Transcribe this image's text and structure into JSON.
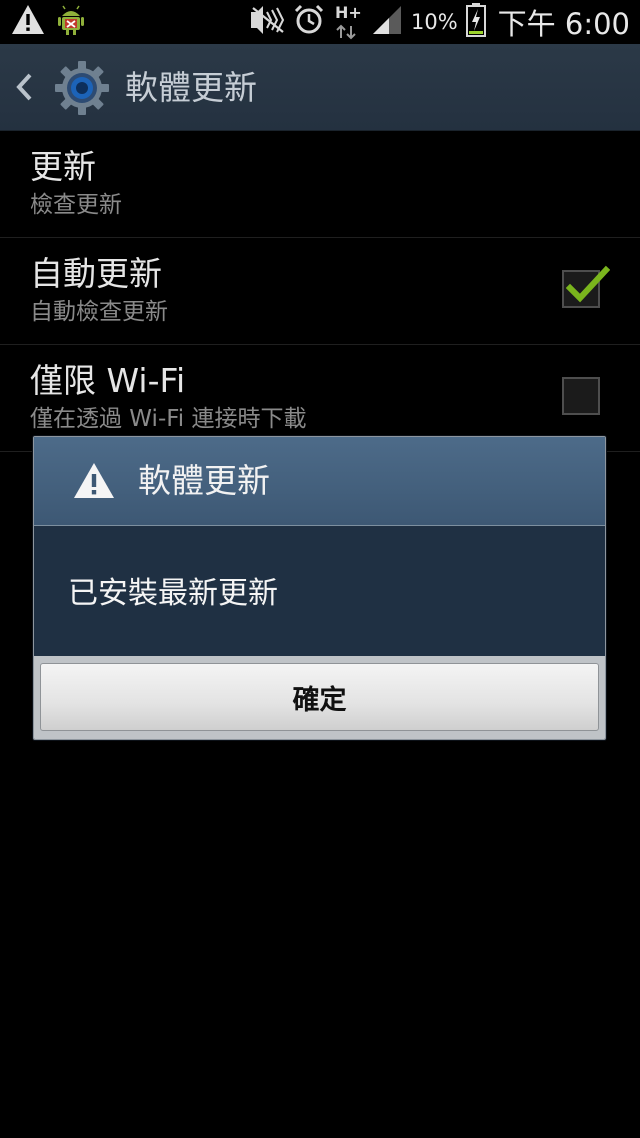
{
  "status_bar": {
    "left_icons": [
      "warning-icon",
      "android-debug-icon"
    ],
    "right_icons": [
      "nfc-muted-icon",
      "alarm-icon",
      "hplus-data-icon",
      "signal-icon",
      "battery-charging-icon"
    ],
    "network_type": "H+",
    "battery_percent": "10%",
    "time": "下午 6:00"
  },
  "action_bar": {
    "title": "軟體更新",
    "back_icon": "chevron-left-icon",
    "app_icon": "gear-icon"
  },
  "settings": {
    "items": [
      {
        "title": "更新",
        "summary": "檢查更新",
        "has_checkbox": false
      },
      {
        "title": "自動更新",
        "summary": "自動檢查更新",
        "has_checkbox": true,
        "checked": true
      },
      {
        "title": "僅限 Wi-Fi",
        "summary": "僅在透過 Wi-Fi 連接時下載",
        "has_checkbox": true,
        "checked": false
      }
    ]
  },
  "dialog": {
    "icon": "warning-icon",
    "title": "軟體更新",
    "message": "已安裝最新更新",
    "ok_label": "確定"
  },
  "colors": {
    "action_bar": "#2b3947",
    "dialog_header": "#4d6b89",
    "dialog_body": "#1f3043",
    "check_green": "#7ab51d"
  }
}
